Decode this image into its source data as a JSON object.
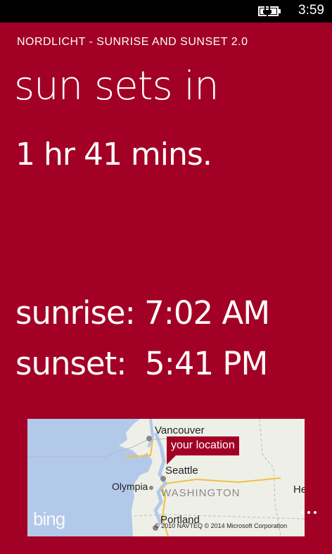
{
  "status_bar": {
    "time": "3:59"
  },
  "app": {
    "title": "NORDLICHT - SUNRISE AND SUNSET 2.0"
  },
  "main": {
    "headline": "sun sets in",
    "countdown": "1 hr 41 mins.",
    "sunrise": {
      "label": "sunrise:",
      "value": "7:02 AM"
    },
    "sunset": {
      "label": "sunset:",
      "value": "5:41 PM"
    }
  },
  "map": {
    "pin_label": "your location",
    "places": {
      "vancouver": "Vancouver",
      "seattle": "Seattle",
      "olympia": "Olympia",
      "washington": "WASHINGTON",
      "portland": "Portland",
      "he": "He"
    },
    "brand": "bing",
    "copyright": "© 2010 NAVTEQ   © 2014 Microsoft Corporation"
  },
  "colors": {
    "accent": "#a20025",
    "water": "#b3c9ea",
    "land": "#eef0e8"
  }
}
